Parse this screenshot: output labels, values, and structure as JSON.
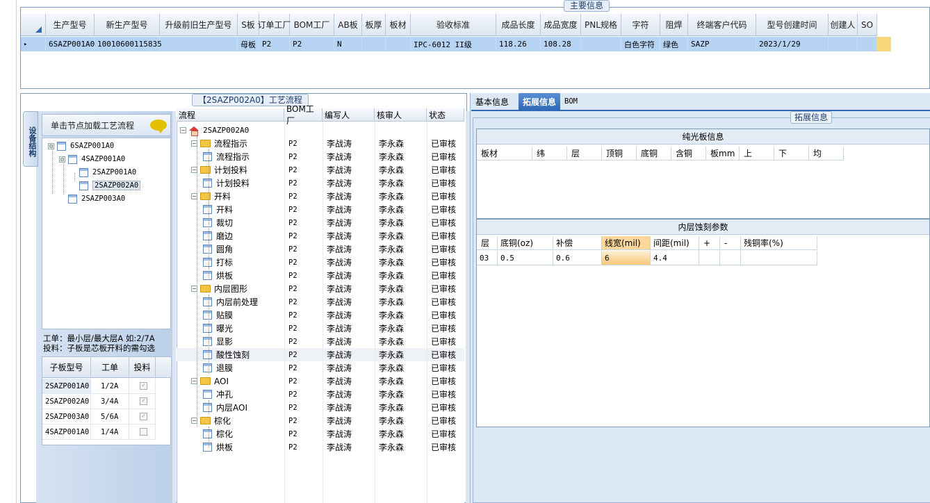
{
  "main_info": {
    "caption": "主要信息",
    "columns": [
      "生产型号",
      "新生产型号",
      "升级前旧生产型号",
      "S板",
      "订单工厂",
      "BOM工厂",
      "AB板",
      "板厚",
      "板材",
      "验收标准",
      "成品长度",
      "成品宽度",
      "PNL规格",
      "字符",
      "阻焊",
      "终端客户代码",
      "型号创建时间",
      "创建人",
      "SO"
    ],
    "row": [
      "6SAZP001A0",
      "10010600115835",
      "",
      "母板",
      "P2",
      "P2",
      "N",
      "",
      "",
      "IPC-6012 II级",
      "118.26",
      "108.28",
      "",
      "白色字符",
      "绿色",
      "SAZP",
      "2023/1/29",
      "",
      ""
    ],
    "row_marker": "▸"
  },
  "side_tab": "设备结构",
  "load_hint": "单击节点加载工艺流程",
  "structure_tree": [
    {
      "label": "6SAZP001A0",
      "toggle": "⊟"
    },
    {
      "label": "4SAZP001A0",
      "toggle": "⊟"
    },
    {
      "label": "2SAZP001A0",
      "toggle": ""
    },
    {
      "label": "2SAZP002A0",
      "toggle": ""
    },
    {
      "label": "2SAZP003A0",
      "toggle": ""
    }
  ],
  "note": {
    "line1": "工单：最小层/最大层A 如:2/7A",
    "line2": "投料：子板是芯板开料的需勾选"
  },
  "sub_grid": {
    "headers": [
      "子板型号",
      "工单",
      "投料"
    ],
    "rows": [
      {
        "model": "2SAZP001A0",
        "order": "1/2A",
        "checked": "✓"
      },
      {
        "model": "2SAZP002A0",
        "order": "3/4A",
        "checked": "✓"
      },
      {
        "model": "2SAZP003A0",
        "order": "5/6A",
        "checked": "✓"
      },
      {
        "model": "4SAZP001A0",
        "order": "1/4A",
        "checked": ""
      }
    ]
  },
  "process": {
    "caption": "【2SAZP002A0】工艺流程",
    "headers": [
      "流程",
      "BOM工厂",
      "编写人",
      "核审人",
      "状态"
    ],
    "rows": [
      {
        "name": "2SAZP002A0",
        "type": "root",
        "bom": "",
        "writer": "",
        "reviewer": "",
        "status": ""
      },
      {
        "name": "流程指示",
        "type": "folder",
        "bom": "P2",
        "writer": "李战涛",
        "reviewer": "李永森",
        "status": "已审核"
      },
      {
        "name": "流程指示",
        "type": "doc",
        "bom": "P2",
        "writer": "李战涛",
        "reviewer": "李永森",
        "status": "已审核"
      },
      {
        "name": "计划投料",
        "type": "folder",
        "bom": "P2",
        "writer": "李战涛",
        "reviewer": "李永森",
        "status": "已审核"
      },
      {
        "name": "计划投料",
        "type": "doc",
        "bom": "P2",
        "writer": "李战涛",
        "reviewer": "李永森",
        "status": "已审核"
      },
      {
        "name": "开料",
        "type": "folder",
        "bom": "P2",
        "writer": "李战涛",
        "reviewer": "李永森",
        "status": "已审核"
      },
      {
        "name": "开料",
        "type": "doc",
        "bom": "P2",
        "writer": "李战涛",
        "reviewer": "李永森",
        "status": "已审核"
      },
      {
        "name": "裁切",
        "type": "doc",
        "bom": "P2",
        "writer": "李战涛",
        "reviewer": "李永森",
        "status": "已审核"
      },
      {
        "name": "磨边",
        "type": "doc",
        "bom": "P2",
        "writer": "李战涛",
        "reviewer": "李永森",
        "status": "已审核"
      },
      {
        "name": "圆角",
        "type": "doc",
        "bom": "P2",
        "writer": "李战涛",
        "reviewer": "李永森",
        "status": "已审核"
      },
      {
        "name": "打标",
        "type": "doc",
        "bom": "P2",
        "writer": "李战涛",
        "reviewer": "李永森",
        "status": "已审核"
      },
      {
        "name": "烘板",
        "type": "doc",
        "bom": "P2",
        "writer": "李战涛",
        "reviewer": "李永森",
        "status": "已审核"
      },
      {
        "name": "内层图形",
        "type": "folder",
        "bom": "P2",
        "writer": "李战涛",
        "reviewer": "李永森",
        "status": "已审核"
      },
      {
        "name": "内层前处理",
        "type": "doc",
        "bom": "P2",
        "writer": "李战涛",
        "reviewer": "李永森",
        "status": "已审核"
      },
      {
        "name": "贴膜",
        "type": "doc",
        "bom": "P2",
        "writer": "李战涛",
        "reviewer": "李永森",
        "status": "已审核"
      },
      {
        "name": "曝光",
        "type": "doc",
        "bom": "P2",
        "writer": "李战涛",
        "reviewer": "李永森",
        "status": "已审核"
      },
      {
        "name": "显影",
        "type": "doc",
        "bom": "P2",
        "writer": "李战涛",
        "reviewer": "李永森",
        "status": "已审核"
      },
      {
        "name": "酸性蚀刻",
        "type": "doc",
        "bom": "P2",
        "writer": "李战涛",
        "reviewer": "李永森",
        "status": "已审核"
      },
      {
        "name": "退膜",
        "type": "doc",
        "bom": "P2",
        "writer": "李战涛",
        "reviewer": "李永森",
        "status": "已审核"
      },
      {
        "name": "AOI",
        "type": "folder",
        "bom": "P2",
        "writer": "李战涛",
        "reviewer": "李永森",
        "status": "已审核"
      },
      {
        "name": "冲孔",
        "type": "doc",
        "bom": "P2",
        "writer": "李战涛",
        "reviewer": "李永森",
        "status": "已审核"
      },
      {
        "name": "内层AOI",
        "type": "doc",
        "bom": "P2",
        "writer": "李战涛",
        "reviewer": "李永森",
        "status": "已审核"
      },
      {
        "name": "棕化",
        "type": "folder",
        "bom": "P2",
        "writer": "李战涛",
        "reviewer": "李永森",
        "status": "已审核"
      },
      {
        "name": "棕化",
        "type": "doc",
        "bom": "P2",
        "writer": "李战涛",
        "reviewer": "李永森",
        "status": "已审核"
      },
      {
        "name": "烘板",
        "type": "doc",
        "bom": "P2",
        "writer": "李战涛",
        "reviewer": "李永森",
        "status": "已审核"
      }
    ]
  },
  "right_tabs": [
    "基本信息",
    "拓展信息",
    "BOM"
  ],
  "ext_caption": "拓展信息",
  "bare_board": {
    "title": "纯光板信息",
    "headers": [
      "板材",
      "纬",
      "层",
      "顶铜",
      "底铜",
      "含铜",
      "板mm",
      "上",
      "下",
      "均"
    ]
  },
  "inner_etch": {
    "title": "内层蚀刻参数",
    "headers": [
      "层",
      "底铜(oz)",
      "补偿",
      "线宽(mil)",
      "间距(mil)",
      "+",
      "-",
      "残铜率(%)"
    ],
    "row": [
      "03",
      "0.5",
      "0.6",
      "6",
      "4.4",
      "",
      "",
      ""
    ]
  },
  "colors": {
    "accent": "#2f6ab8",
    "selection": "#b7d3f3",
    "highlight": "#f7c679"
  }
}
